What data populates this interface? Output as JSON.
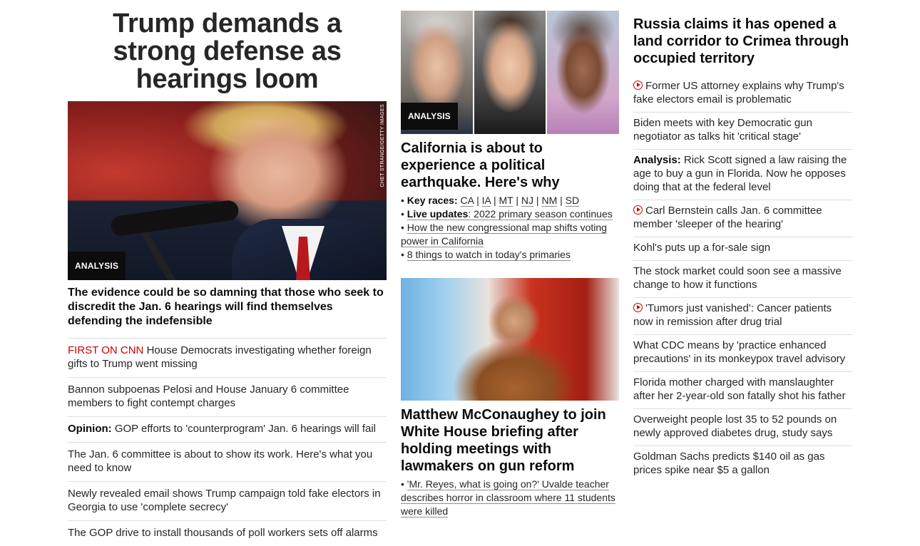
{
  "left": {
    "headline": "Trump demands a strong defense as hearings loom",
    "image_credit": "CHET STRANGE/GETTY IMAGES",
    "badge": "ANALYSIS",
    "subheadline": "The evidence could be so damning that those who seek to discredit the Jan. 6 hearings will find themselves defending the indefensible",
    "stories": [
      {
        "prefix": "FIRST ON CNN",
        "text": " House Democrats investigating whether foreign gifts to Trump went missing"
      },
      {
        "prefix": "",
        "text": "Bannon subpoenas Pelosi and House January 6 committee members to fight contempt charges"
      },
      {
        "prefix": "Opinion:",
        "text": " GOP efforts to 'counterprogram' Jan. 6 hearings will fail"
      },
      {
        "prefix": "",
        "text": "The Jan. 6 committee is about to show its work. Here's what you need to know"
      },
      {
        "prefix": "",
        "text": "Newly revealed email shows Trump campaign told fake electors in Georgia to use 'complete secrecy'"
      },
      {
        "prefix": "",
        "text": "The GOP drive to install thousands of poll workers sets off alarms"
      }
    ]
  },
  "middle": {
    "badge": "ANALYSIS",
    "headline1": "California is about to experience a political earthquake. Here's why",
    "key_races_label": "Key races:",
    "key_races": [
      "CA",
      "IA",
      "MT",
      "NJ",
      "NM",
      "SD"
    ],
    "live_updates_label": "Live updates",
    "live_updates_text": ": 2022 primary season continues",
    "bullet3": "How the new congressional map shifts voting power in California",
    "bullet4": "8 things to watch in today's primaries",
    "headline2": "Matthew McConaughey to join White House briefing after holding meetings with lawmakers on gun reform",
    "bullet5": "'Mr. Reyes, what is going on?' Uvalde teacher describes horror in classroom where 11 students were killed"
  },
  "right": {
    "headline": "Russia claims it has opened a land corridor to Crimea through occupied territory",
    "stories": [
      {
        "video": true,
        "prefix": "",
        "text": "Former US attorney explains why Trump's fake electors email is problematic"
      },
      {
        "video": false,
        "prefix": "",
        "text": "Biden meets with key Democratic gun negotiator as talks hit 'critical stage'"
      },
      {
        "video": false,
        "prefix": "Analysis:",
        "text": " Rick Scott signed a law raising the age to buy a gun in Florida. Now he opposes doing that at the federal level"
      },
      {
        "video": true,
        "prefix": "",
        "text": "Carl Bernstein calls Jan. 6 committee member 'sleeper of the hearing'"
      },
      {
        "video": false,
        "prefix": "",
        "text": "Kohl's puts up a for-sale sign"
      },
      {
        "video": false,
        "prefix": "",
        "text": "The stock market could soon see a massive change to how it functions"
      },
      {
        "video": true,
        "prefix": "",
        "text": "'Tumors just vanished': Cancer patients now in remission after drug trial"
      },
      {
        "video": false,
        "prefix": "",
        "text": "What CDC means by 'practice enhanced precautions' in its monkeypox travel advisory"
      },
      {
        "video": false,
        "prefix": "",
        "text": "Florida mother charged with manslaughter after her 2-year-old son fatally shot his father"
      },
      {
        "video": false,
        "prefix": "",
        "text": "Overweight people lost 35 to 52 pounds on newly approved diabetes drug, study says"
      },
      {
        "video": false,
        "prefix": "",
        "text": "Goldman Sachs predicts $140 oil as gas prices spike near $5 a gallon"
      }
    ]
  },
  "colors": {
    "accent_red": "#cc0000",
    "text": "#0c0c0c",
    "divider": "#dfdfdf"
  }
}
